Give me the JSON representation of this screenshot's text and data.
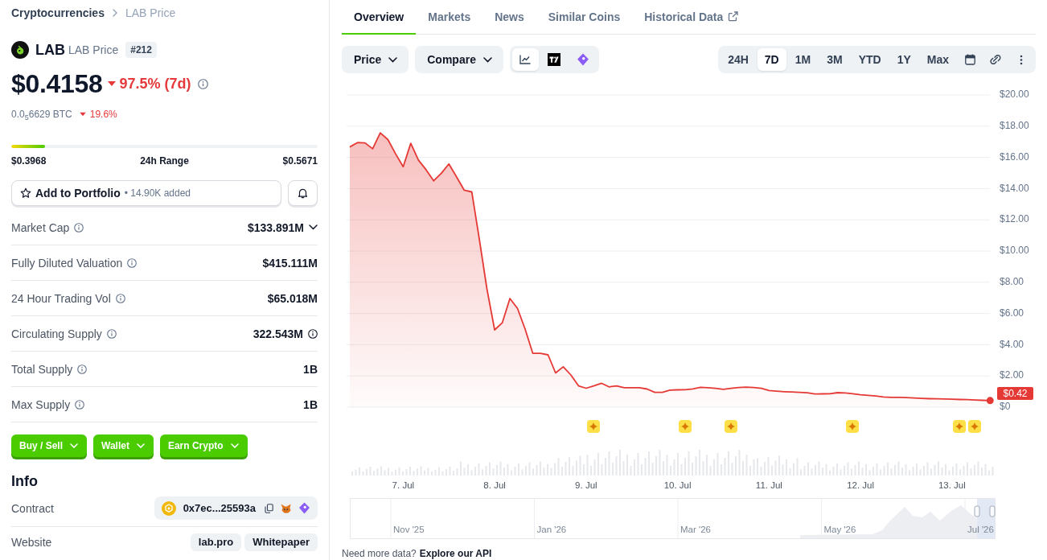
{
  "breadcrumb": [
    "Cryptocurrencies",
    "LAB Price"
  ],
  "coin": {
    "symbol": "LAB",
    "name": "LAB Price",
    "rank": "#212"
  },
  "price": {
    "value": "$0.4158",
    "change": "97.5% (7d)",
    "negative": true
  },
  "btc_price": {
    "value": "0.0$_{5}$6629 BTC",
    "change": "19.6%",
    "negative": true
  },
  "range": {
    "low": "$0.3968",
    "label": "24h Range",
    "high": "$0.5671",
    "level": 0.11
  },
  "portfolio": {
    "label": "Add to Portfolio",
    "count": "• 14.90K added"
  },
  "stats": [
    {
      "label": "Market Cap",
      "value": "$133.891M",
      "expandable": true,
      "value_info": false
    },
    {
      "label": "Fully Diluted Valuation",
      "value": "$415.111M",
      "expandable": false,
      "value_info": false
    },
    {
      "label": "24 Hour Trading Vol",
      "value": "$65.018M",
      "expandable": false,
      "value_info": false
    },
    {
      "label": "Circulating Supply",
      "value": "322.543M",
      "expandable": false,
      "value_info": true
    },
    {
      "label": "Total Supply",
      "value": "1B",
      "expandable": false,
      "value_info": false
    },
    {
      "label": "Max Supply",
      "value": "1B",
      "expandable": false,
      "value_info": false
    }
  ],
  "action_buttons": [
    "Buy / Sell",
    "Wallet",
    "Earn Crypto"
  ],
  "info": {
    "title": "Info",
    "contract": {
      "label": "Contract",
      "address": "0x7ec...25593a"
    },
    "website": {
      "label": "Website",
      "links": [
        "lab.pro",
        "Whitepaper"
      ]
    }
  },
  "tabs": [
    {
      "label": "Overview",
      "selected": true,
      "external": false
    },
    {
      "label": "Markets",
      "selected": false,
      "external": false
    },
    {
      "label": "News",
      "selected": false,
      "external": false
    },
    {
      "label": "Similar Coins",
      "selected": false,
      "external": false
    },
    {
      "label": "Historical Data",
      "selected": false,
      "external": true
    }
  ],
  "chart_selectors": [
    "Price",
    "Compare"
  ],
  "chart_views": [
    {
      "kind": "line",
      "selected": true
    },
    {
      "kind": "tv",
      "selected": false
    },
    {
      "kind": "gem",
      "selected": false
    }
  ],
  "range_buttons": [
    {
      "label": "24H",
      "selected": false
    },
    {
      "label": "7D",
      "selected": true
    },
    {
      "label": "1M",
      "selected": false
    },
    {
      "label": "3M",
      "selected": false
    },
    {
      "label": "YTD",
      "selected": false
    },
    {
      "label": "1Y",
      "selected": false
    },
    {
      "label": "Max",
      "selected": false
    }
  ],
  "chart": {
    "current_label": "$0.42",
    "chart_data": {
      "type": "area",
      "grid": true,
      "categories": [
        null,
        null,
        null,
        null,
        null,
        null,
        null,
        "7. Jul",
        null,
        null,
        null,
        null,
        null,
        null,
        null,
        null,
        null,
        null,
        null,
        "8. Jul",
        null,
        null,
        null,
        null,
        null,
        null,
        null,
        null,
        null,
        null,
        null,
        "9. Jul",
        null,
        null,
        null,
        null,
        null,
        null,
        null,
        null,
        null,
        null,
        null,
        "10. Jul",
        null,
        null,
        null,
        null,
        null,
        null,
        null,
        null,
        null,
        null,
        null,
        "11. Jul",
        null,
        null,
        null,
        null,
        null,
        null,
        null,
        null,
        null,
        null,
        null,
        "12. Jul",
        null,
        null,
        null,
        null,
        null,
        null,
        null,
        null,
        null,
        null,
        null,
        "13. Jul",
        null,
        null,
        null,
        null,
        null
      ],
      "series": [
        {
          "color": "#e53935",
          "values": [
            16.67,
            16.95,
            16.93,
            16.55,
            17.57,
            17.14,
            16.23,
            15.4,
            16.9,
            15.83,
            15.21,
            14.5,
            14.98,
            15.58,
            14.75,
            13.9,
            13.79,
            10.75,
            7.55,
            4.95,
            5.4,
            6.96,
            6.33,
            5.0,
            3.45,
            3.45,
            3.35,
            2.19,
            2.58,
            2.06,
            1.36,
            1.21,
            1.36,
            1.53,
            1.3,
            1.36,
            1.25,
            1.25,
            1.25,
            1.16,
            0.95,
            0.95,
            1.09,
            1.11,
            1.12,
            1.17,
            1.27,
            1.24,
            1.2,
            1.14,
            1.2,
            1.26,
            1.28,
            1.26,
            1.2,
            1.06,
            1.02,
            0.99,
            0.97,
            0.95,
            0.92,
            0.84,
            0.85,
            0.86,
            0.93,
            0.91,
            0.86,
            0.79,
            0.75,
            0.71,
            0.65,
            0.63,
            0.63,
            0.61,
            0.58,
            0.56,
            0.54,
            0.53,
            0.52,
            0.51,
            0.49,
            0.48,
            0.46,
            0.44,
            0.42
          ]
        }
      ],
      "ylim": [
        0,
        20
      ],
      "yticks": [
        {
          "value": 0,
          "label": "$0"
        },
        {
          "value": 2,
          "label": "$2.00"
        },
        {
          "value": 4,
          "label": "$4.00"
        },
        {
          "value": 6,
          "label": "$6.00"
        },
        {
          "value": 8,
          "label": "$8.00"
        },
        {
          "value": 10,
          "label": "$10.00"
        },
        {
          "value": 12,
          "label": "$12.00"
        },
        {
          "value": 14,
          "label": "$14.00"
        },
        {
          "value": 16,
          "label": "$16.00"
        },
        {
          "value": 18,
          "label": "$18.00"
        },
        {
          "value": 20,
          "label": "$20.00"
        }
      ]
    }
  },
  "navigator": {
    "labels": [
      "Nov '25",
      "Jan '26",
      "Mar '26",
      "May '26",
      "Jul '26"
    ]
  },
  "api_prompt": {
    "text": "Need more data?",
    "link": "Explore our API"
  }
}
